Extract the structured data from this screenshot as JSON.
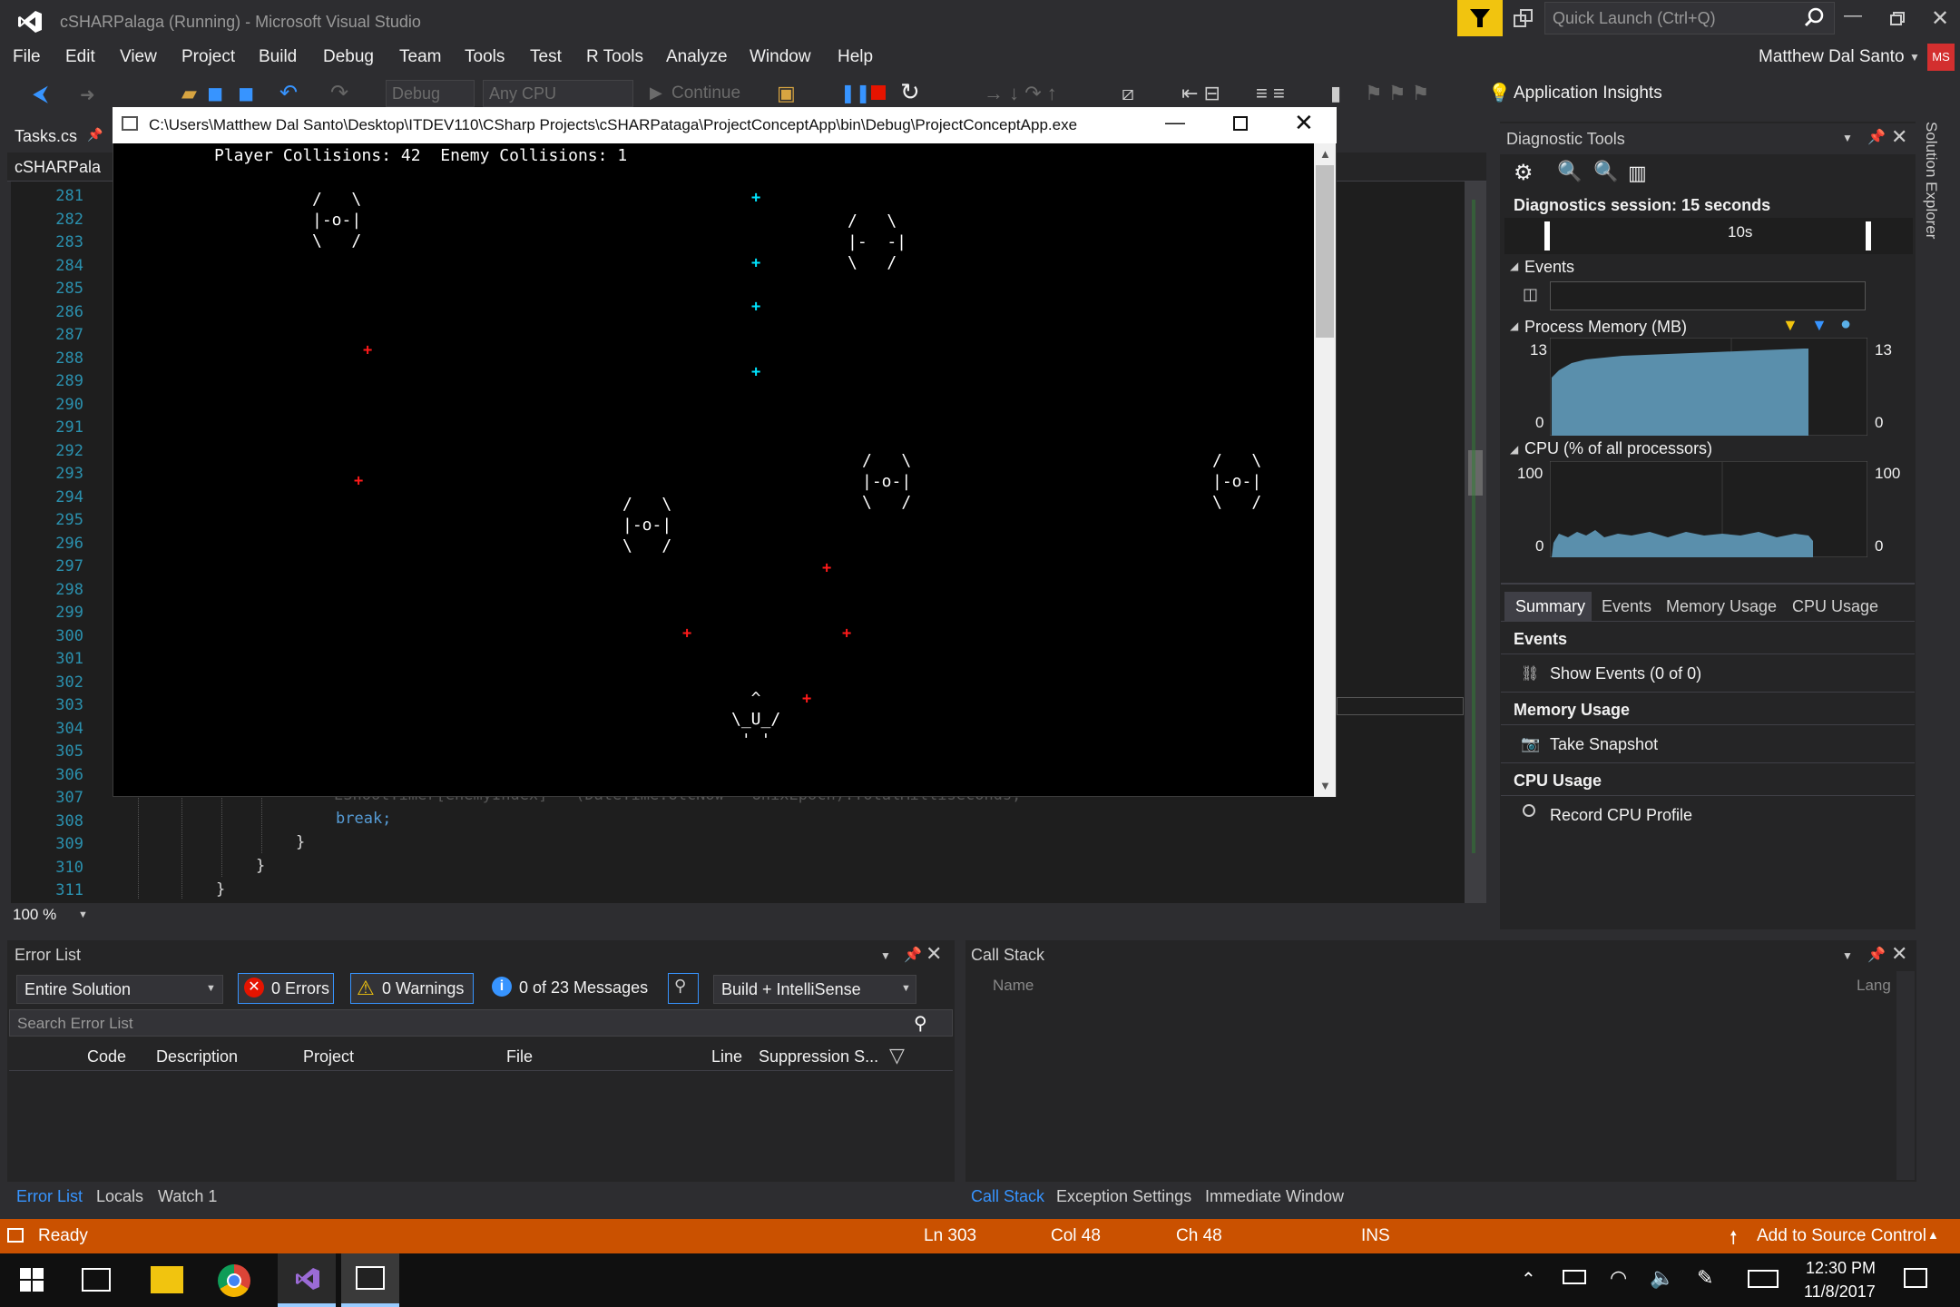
{
  "window": {
    "title": "cSHARPalaga (Running) - Microsoft Visual Studio",
    "quick_launch_placeholder": "Quick Launch (Ctrl+Q)",
    "user": "Matthew Dal Santo",
    "user_initials": "MS"
  },
  "menu": [
    "File",
    "Edit",
    "View",
    "Project",
    "Build",
    "Debug",
    "Team",
    "Tools",
    "Test",
    "R Tools",
    "Analyze",
    "Window",
    "Help"
  ],
  "toolbar": {
    "config": "Debug",
    "platform": "Any CPU",
    "continue": "Continue",
    "app_insights": "Application Insights"
  },
  "doc_tabs": {
    "tab1": "Tasks.cs",
    "tab2": "cSHARPala"
  },
  "editor": {
    "line_numbers": [
      "281",
      "282",
      "283",
      "284",
      "285",
      "286",
      "287",
      "288",
      "289",
      "290",
      "291",
      "292",
      "293",
      "294",
      "295",
      "296",
      "297",
      "298",
      "299",
      "300",
      "301",
      "302",
      "303",
      "304",
      "305",
      "306",
      "307",
      "308",
      "309",
      "310",
      "311"
    ],
    "code_break": "break;",
    "brace1": "}",
    "brace2": "}",
    "brace3": "}",
    "zoom": "100 %"
  },
  "console": {
    "path": "C:\\Users\\Matthew Dal Santo\\Desktop\\ITDEV110\\CSharp Projects\\cSHARPataga\\ProjectConceptApp\\bin\\Debug\\ProjectConceptApp.exe",
    "status_line": "Player Collisions: 42  Enemy Collisions: 1",
    "enemy_sprite": "/   \\\n|-o-|\n\\   /",
    "enemy_hit_sprite": "/   \\\n|-  -|\n\\   /",
    "player_sprite": "  ^\n\\_U_/\n ' '",
    "star_char": "+"
  },
  "diagnostics": {
    "title": "Diagnostic Tools",
    "session": "Diagnostics session: 15 seconds",
    "timeline_label": "10s",
    "events_label": "Events",
    "memory_label": "Process Memory (MB)",
    "memory_max": "13",
    "memory_min": "0",
    "cpu_label": "CPU (% of all processors)",
    "cpu_max": "100",
    "cpu_min": "0",
    "tabs": [
      "Summary",
      "Events",
      "Memory Usage",
      "CPU Usage"
    ],
    "events_heading": "Events",
    "show_events": "Show Events (0 of 0)",
    "memory_heading": "Memory Usage",
    "take_snapshot": "Take Snapshot",
    "cpu_heading": "CPU Usage",
    "record_cpu": "Record CPU Profile",
    "solution_explorer": "Solution Explorer",
    "colors": {
      "chart_fill": "#5a8fac",
      "accent": "#ca5100"
    }
  },
  "errorlist": {
    "title": "Error List",
    "scope": "Entire Solution",
    "errors": "0 Errors",
    "warnings": "0 Warnings",
    "messages": "0 of 23 Messages",
    "build_filter": "Build + IntelliSense",
    "search_placeholder": "Search Error List",
    "columns": [
      "Code",
      "Description",
      "Project",
      "File",
      "Line",
      "Suppression S..."
    ],
    "bottom_tabs": [
      "Error List",
      "Locals",
      "Watch 1"
    ]
  },
  "callstack": {
    "title": "Call Stack",
    "col_name": "Name",
    "col_lang": "Lang",
    "bottom_tabs": [
      "Call Stack",
      "Exception Settings",
      "Immediate Window"
    ]
  },
  "status": {
    "ready": "Ready",
    "ln": "Ln 303",
    "col": "Col 48",
    "ch": "Ch 48",
    "ins": "INS",
    "source_control": "Add to Source Control"
  },
  "taskbar": {
    "time": "12:30 PM",
    "date": "11/8/2017"
  }
}
